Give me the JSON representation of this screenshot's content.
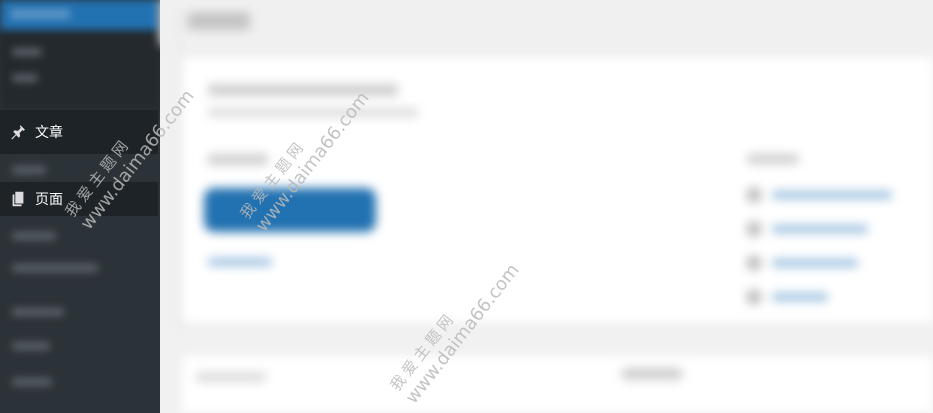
{
  "sidebar": {
    "items": [
      {
        "label": "文章",
        "icon": "pin-icon"
      },
      {
        "label": "页面",
        "icon": "pages-icon"
      }
    ]
  },
  "watermark": {
    "cn": "我爱主题网",
    "en": "www.daima66.com"
  },
  "colors": {
    "sidebar_bg": "#2c3338",
    "sidebar_active": "#1d2327",
    "accent": "#2271b1",
    "page_bg": "#f1f1f1"
  }
}
